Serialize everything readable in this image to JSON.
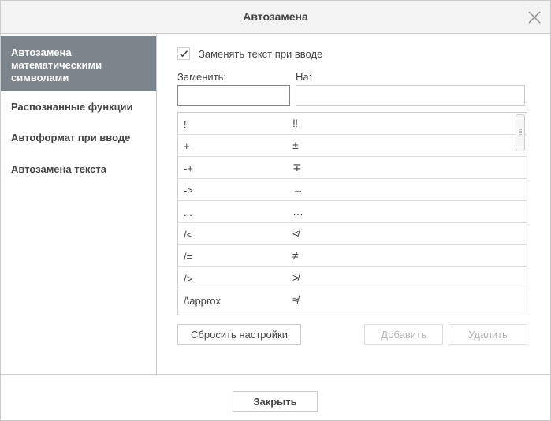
{
  "dialog": {
    "title": "Автозамена",
    "close_icon": "close-icon"
  },
  "sidebar": {
    "items": [
      {
        "label": "Автозамена математическими символами",
        "active": true
      },
      {
        "label": "Распознанные функции",
        "active": false
      },
      {
        "label": "Автоформат при вводе",
        "active": false
      },
      {
        "label": "Автозамена текста",
        "active": false
      }
    ]
  },
  "options": {
    "replace_while_typing_label": "Заменять текст при вводе",
    "replace_while_typing_checked": true
  },
  "form": {
    "replace_label": "Заменить:",
    "with_label": "На:",
    "replace_value": "",
    "with_value": ""
  },
  "table": {
    "rows": [
      {
        "from": "!!",
        "to": "‼"
      },
      {
        "from": "+-",
        "to": "±"
      },
      {
        "from": "-+",
        "to": "∓"
      },
      {
        "from": "->",
        "to": "→"
      },
      {
        "from": "...",
        "to": "…"
      },
      {
        "from": "/<",
        "to": "≮"
      },
      {
        "from": "/=",
        "to": "≠"
      },
      {
        "from": "/>",
        "to": "≯"
      },
      {
        "from": "/\\approx",
        "to": "≉"
      }
    ]
  },
  "actions": {
    "reset_label": "Сбросить настройки",
    "add_label": "Добавить",
    "delete_label": "Удалить"
  },
  "footer": {
    "close_label": "Закрыть"
  },
  "colors": {
    "active_item_bg": "#7d858c",
    "border": "#cbcbcb",
    "header_bg": "#f3f3f3"
  }
}
